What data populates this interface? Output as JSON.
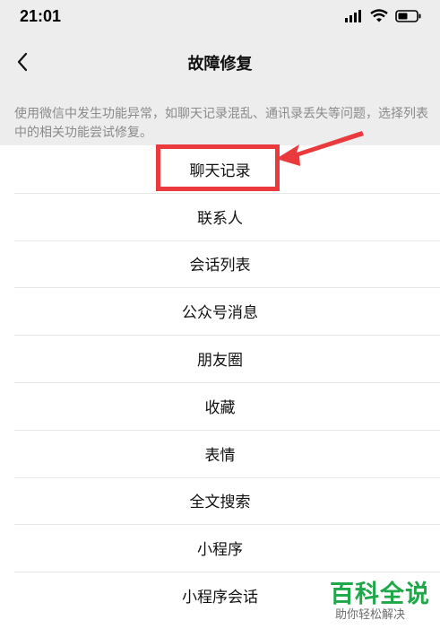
{
  "status_bar": {
    "time": "21:01"
  },
  "nav": {
    "title": "故障修复",
    "back_icon": "chevron-left-icon"
  },
  "description": "使用微信中发生功能异常，如聊天记录混乱、通讯录丢失等问题，选择列表中的相关功能尝试修复。",
  "repair_items": [
    {
      "label": "聊天记录"
    },
    {
      "label": "联系人"
    },
    {
      "label": "会话列表"
    },
    {
      "label": "公众号消息"
    },
    {
      "label": "朋友圈"
    },
    {
      "label": "收藏"
    },
    {
      "label": "表情"
    },
    {
      "label": "全文搜索"
    },
    {
      "label": "小程序"
    },
    {
      "label": "小程序会话"
    }
  ],
  "annotation": {
    "color": "#ea3a3d"
  },
  "watermark": {
    "brand": "百科全说",
    "tagline": "助你轻松解决",
    "color": "#1fa84a"
  }
}
